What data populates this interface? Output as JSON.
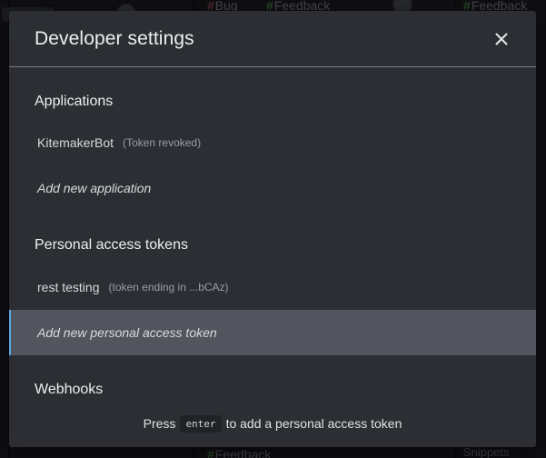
{
  "background": {
    "tags": [
      {
        "hash": "#",
        "label": "Bug"
      },
      {
        "hash": "#",
        "label": "Feedback"
      },
      {
        "hash": "#",
        "label": "Feedback"
      },
      {
        "hash": "#",
        "label": "Feedback"
      }
    ],
    "bottom_label": "Snippets"
  },
  "modal": {
    "title": "Developer settings",
    "close_icon": "close-icon",
    "sections": {
      "applications": {
        "title": "Applications",
        "item_name": "KitemakerBot",
        "item_note": "(Token revoked)",
        "add_label": "Add new application"
      },
      "tokens": {
        "title": "Personal access tokens",
        "item_name": "rest testing",
        "item_note": "(token ending in ...bCAz)",
        "add_label": "Add new personal access token"
      },
      "webhooks": {
        "title": "Webhooks"
      }
    },
    "footer": {
      "prefix": "Press",
      "key": "enter",
      "suffix": "to add a personal access token"
    }
  },
  "colors": {
    "selection_accent": "#5aa8e6",
    "modal_bg": "#2c2e34",
    "selected_row_bg": "#52555d"
  }
}
